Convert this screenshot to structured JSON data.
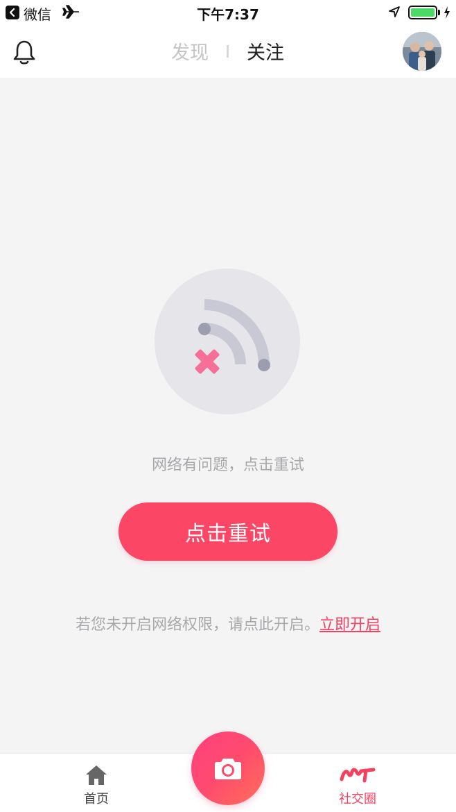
{
  "status_bar": {
    "app_name": "微信",
    "time": "下午7:37",
    "battery_level": 1.0,
    "icons": [
      "back-icon",
      "airplane-icon",
      "location-arrow-icon",
      "battery-icon",
      "charging-bolt-icon"
    ]
  },
  "header": {
    "tabs": [
      {
        "label": "发现",
        "active": false
      },
      {
        "label": "关注",
        "active": true
      }
    ],
    "icons": [
      "bell-icon",
      "avatar"
    ]
  },
  "main": {
    "error_message": "网络有问题，点击重试",
    "retry_button_label": "点击重试",
    "permission_text": "若您未开启网络权限，请点此开启。",
    "permission_link": "立即开启",
    "illustration_icon": "no-network-icon"
  },
  "tabbar": {
    "items": [
      {
        "label": "首页",
        "icon": "home-icon",
        "active": false
      },
      {
        "label": "社交圈",
        "icon": "social-circle-icon",
        "active": true
      }
    ],
    "center_icon": "camera-icon"
  },
  "colors": {
    "accent": "#fb4666",
    "background": "#f4f4f5",
    "muted_text": "#a8a8ab"
  }
}
